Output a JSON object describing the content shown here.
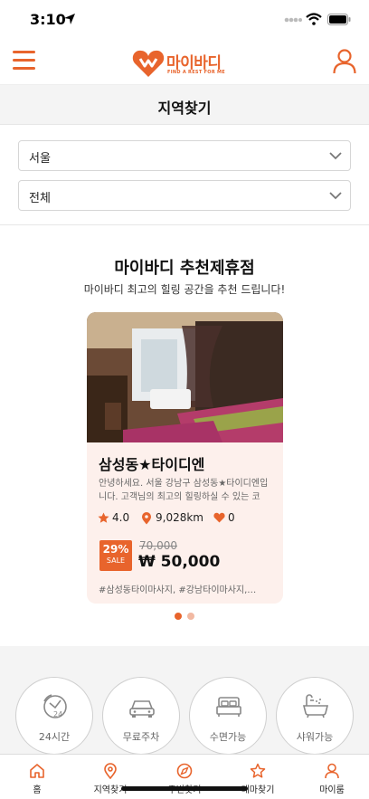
{
  "status_bar": {
    "time": "3:10"
  },
  "header": {
    "logo_text": "마이바디",
    "logo_tagline": "FIND A REST FOR ME"
  },
  "page": {
    "title": "지역찾기"
  },
  "filters": {
    "region": "서울",
    "district": "전체"
  },
  "recommend": {
    "title": "마이바디 추천제휴점",
    "subtitle": "마이바디 최고의 힐링 공간을 추천 드립니다!"
  },
  "card": {
    "name": "삼성동★타이디엔",
    "description": "안녕하세요. 서울 강남구 삼성동★타이디엔입니다. 고객님의 최고의 힐링하실 수 있는 코",
    "rating": "4.0",
    "distance": "9,028km",
    "likes": "0",
    "discount": "29%",
    "sale_label": "SALE",
    "original_price": "70,000",
    "price": "₩ 50,000",
    "hashtags": "#삼성동타이마사지, #강남타이마사지,…"
  },
  "themes": [
    {
      "label": "24시간",
      "icon": "clock-24-icon"
    },
    {
      "label": "무료주차",
      "icon": "car-icon"
    },
    {
      "label": "수면가능",
      "icon": "bed-icon"
    },
    {
      "label": "샤워가능",
      "icon": "bathtub-icon"
    }
  ],
  "tabs": [
    {
      "label": "홈",
      "icon": "home-icon"
    },
    {
      "label": "지역찾기",
      "icon": "map-pin-icon"
    },
    {
      "label": "주변찾기",
      "icon": "compass-icon"
    },
    {
      "label": "테마찾기",
      "icon": "star-icon"
    },
    {
      "label": "마이룸",
      "icon": "person-icon"
    }
  ],
  "colors": {
    "accent": "#e8642c",
    "card_bg": "#fdf0ec",
    "section_bg": "#f4f4f4"
  }
}
